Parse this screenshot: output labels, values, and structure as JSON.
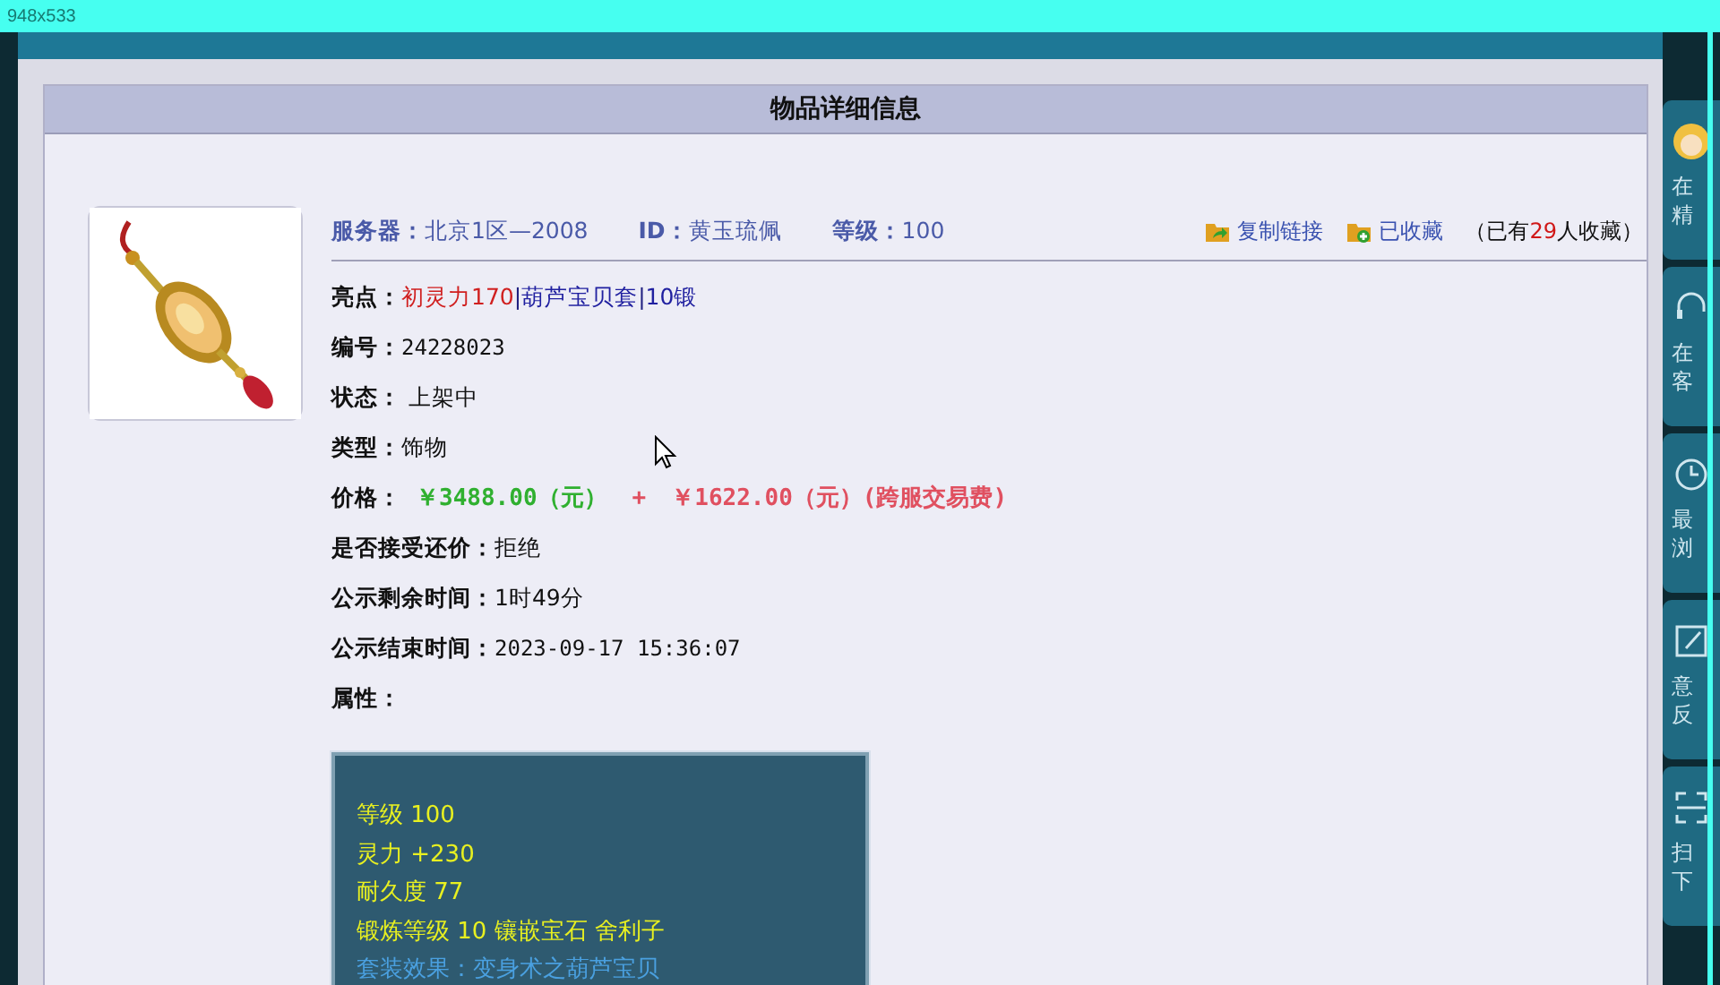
{
  "recorder_label": "948x533",
  "panel": {
    "title": "物品详细信息",
    "meta": [
      {
        "label": "服务器：",
        "value": "北京1区—2008"
      },
      {
        "label": "ID：",
        "value": "黄玉琉佩"
      },
      {
        "label": "等级：",
        "value": "100"
      }
    ],
    "actions": [
      {
        "kind": "share",
        "label": "复制链接"
      },
      {
        "kind": "favorite",
        "label": "已收藏"
      }
    ],
    "favorites": {
      "before": "（已有",
      "count": "29",
      "after": "人收藏）"
    },
    "rows": [
      {
        "kind": "highlights",
        "label": "亮点：",
        "parts": [
          {
            "text": "初灵力170",
            "color": "#d02020"
          },
          {
            "text": "|",
            "color": "#202080"
          },
          {
            "text": "葫芦宝贝套",
            "color": "#2020a0"
          },
          {
            "text": "|",
            "color": "#202080"
          },
          {
            "text": "10锻",
            "color": "#2020a0"
          }
        ]
      },
      {
        "kind": "mono",
        "label": "编号：",
        "value": "24228023"
      },
      {
        "kind": "plain",
        "label": "状态：",
        "value": " 上架中"
      },
      {
        "kind": "plain",
        "label": "类型：",
        "value": "饰物"
      },
      {
        "kind": "price",
        "label": "价格：",
        "price": "￥3488.00（元）",
        "plus": "+",
        "fee": "￥1622.00（元）(跨服交易费)"
      },
      {
        "kind": "plain",
        "label": "是否接受还价：",
        "value": "拒绝"
      },
      {
        "kind": "plain",
        "label": "公示剩余时间：",
        "value": "1时49分"
      },
      {
        "kind": "mono",
        "label": "公示结束时间：",
        "value": "2023-09-17 15:36:07"
      },
      {
        "kind": "plain",
        "label": "属性："
      }
    ],
    "attributes": [
      {
        "kind": "stat",
        "text": "等级 100"
      },
      {
        "kind": "stat",
        "text": "灵力 +230"
      },
      {
        "kind": "stat",
        "text": "耐久度 77"
      },
      {
        "kind": "stat",
        "text": "锻炼等级 10 镶嵌宝石 舍利子"
      },
      {
        "kind": "set",
        "text": "套装效果：变身术之葫芦宝贝"
      }
    ]
  },
  "dock": [
    {
      "kind": "avatar",
      "lines": [
        "在",
        "精"
      ]
    },
    {
      "kind": "headset",
      "lines": [
        "在",
        "客"
      ]
    },
    {
      "kind": "clock",
      "lines": [
        "最",
        "浏"
      ]
    },
    {
      "kind": "edit",
      "lines": [
        "意",
        "反"
      ]
    },
    {
      "kind": "scan",
      "lines": [
        "扫",
        "下"
      ]
    }
  ]
}
